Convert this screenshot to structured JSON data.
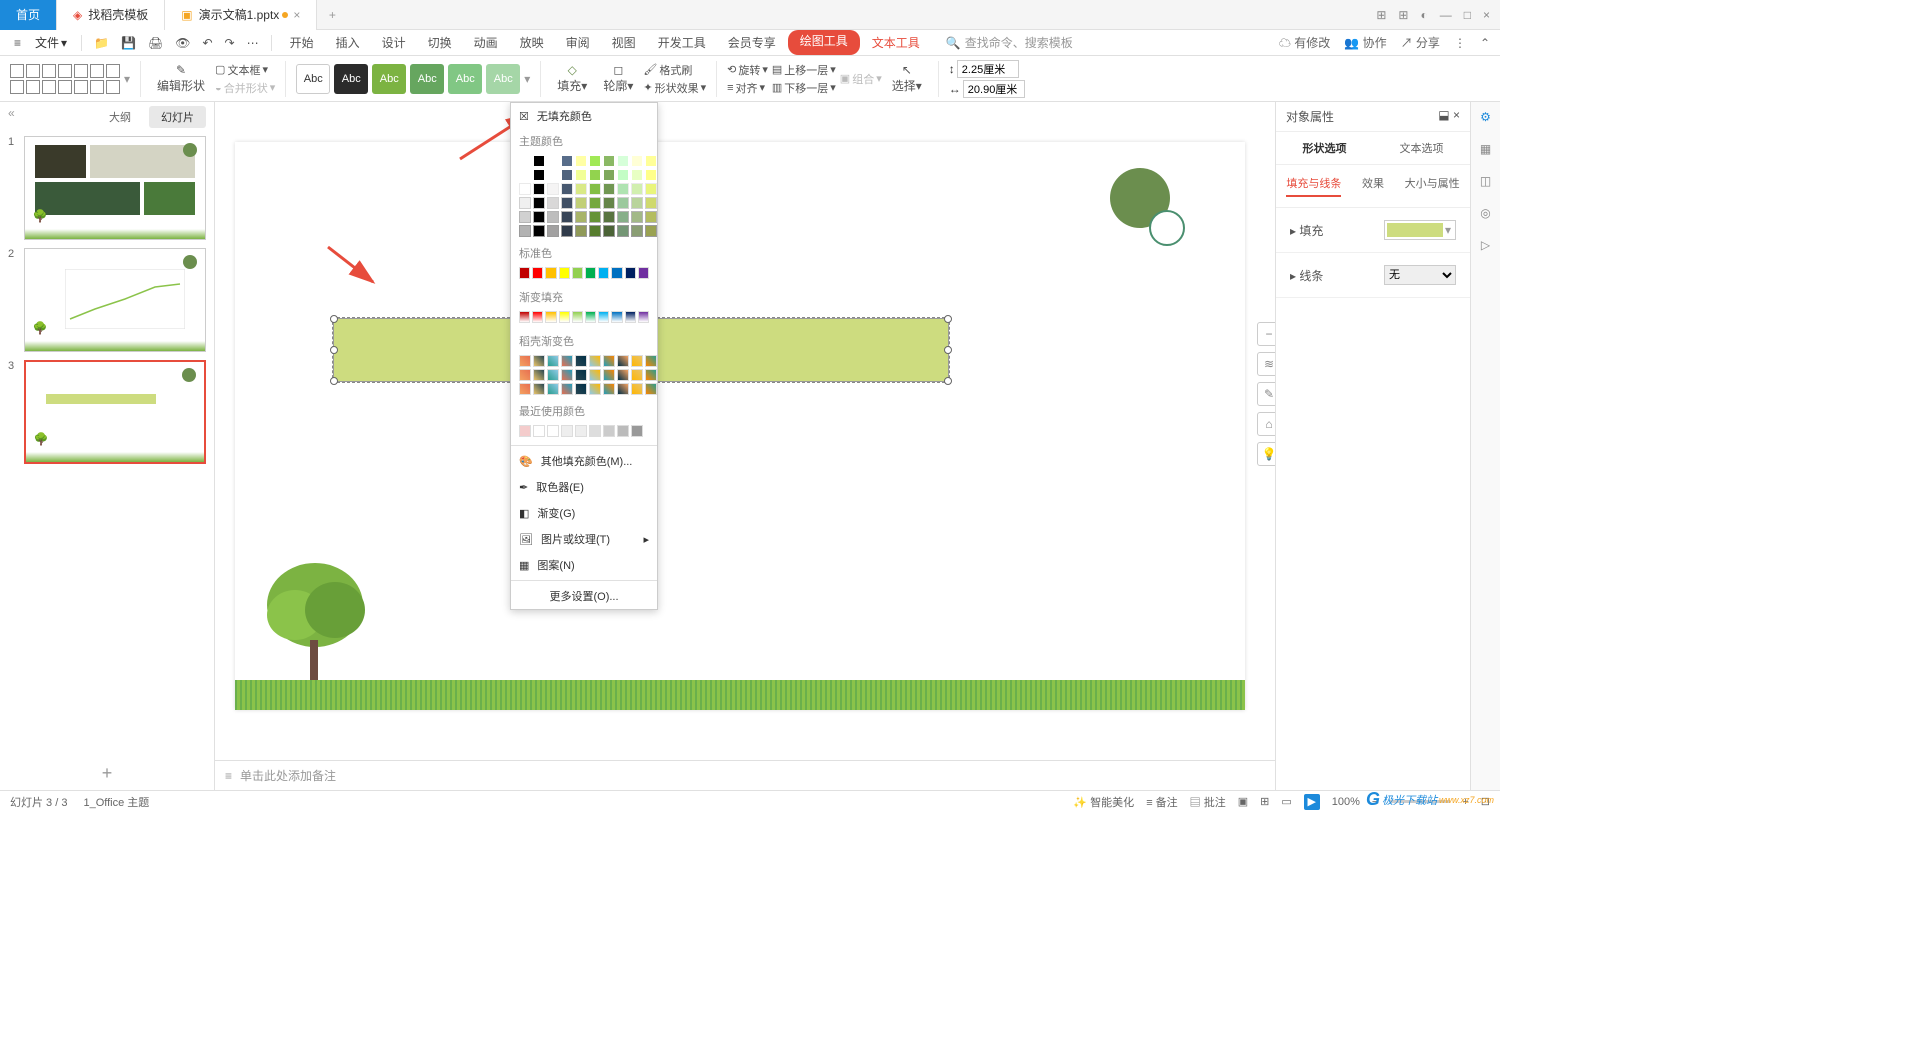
{
  "titlebar": {
    "home": "首页",
    "template": "找稻壳模板",
    "doc": "演示文稿1.pptx"
  },
  "menu": {
    "file": "文件",
    "tabs": [
      "开始",
      "插入",
      "设计",
      "切换",
      "动画",
      "放映",
      "审阅",
      "视图",
      "开发工具",
      "会员专享"
    ],
    "draw_tools": "绘图工具",
    "text_tools": "文本工具",
    "search_ph": "查找命令、搜索模板",
    "pending": "有修改",
    "collab": "协作",
    "share": "分享"
  },
  "ribbon": {
    "edit_shape": "编辑形状",
    "textbox": "文本框",
    "combine_shape": "合并形状",
    "abc": "Abc",
    "fill": "填充",
    "outline": "轮廓",
    "format_painter": "格式刷",
    "shape_effects": "形状效果",
    "rotate": "旋转",
    "align": "对齐",
    "bring_fwd": "上移一层",
    "send_back": "下移一层",
    "group": "组合",
    "select": "选择",
    "width": "2.25厘米",
    "height": "20.90厘米"
  },
  "left": {
    "outline": "大纲",
    "slides": "幻灯片"
  },
  "fill_dd": {
    "no_fill": "无填充颜色",
    "theme": "主题颜色",
    "standard": "标准色",
    "gradient": "渐变填充",
    "preset": "稻壳渐变色",
    "recent": "最近使用颜色",
    "more_colors": "其他填充颜色(M)...",
    "eyedropper": "取色器(E)",
    "gradient_menu": "渐变(G)",
    "picture": "图片或纹理(T)",
    "pattern": "图案(N)",
    "more_settings": "更多设置(O)..."
  },
  "right": {
    "title": "对象属性",
    "shape_opts": "形状选项",
    "text_opts": "文本选项",
    "fill_line": "填充与线条",
    "effects": "效果",
    "size_props": "大小与属性",
    "fill": "填充",
    "line": "线条",
    "line_none": "无"
  },
  "notes": "单击此处添加备注",
  "status": {
    "slide": "幻灯片 3 / 3",
    "theme": "1_Office 主题",
    "beautify": "智能美化",
    "notes": "备注",
    "comments": "批注",
    "zoom": "100%"
  },
  "watermark": "极光下载站",
  "watermark_url": "www.xz7.com"
}
